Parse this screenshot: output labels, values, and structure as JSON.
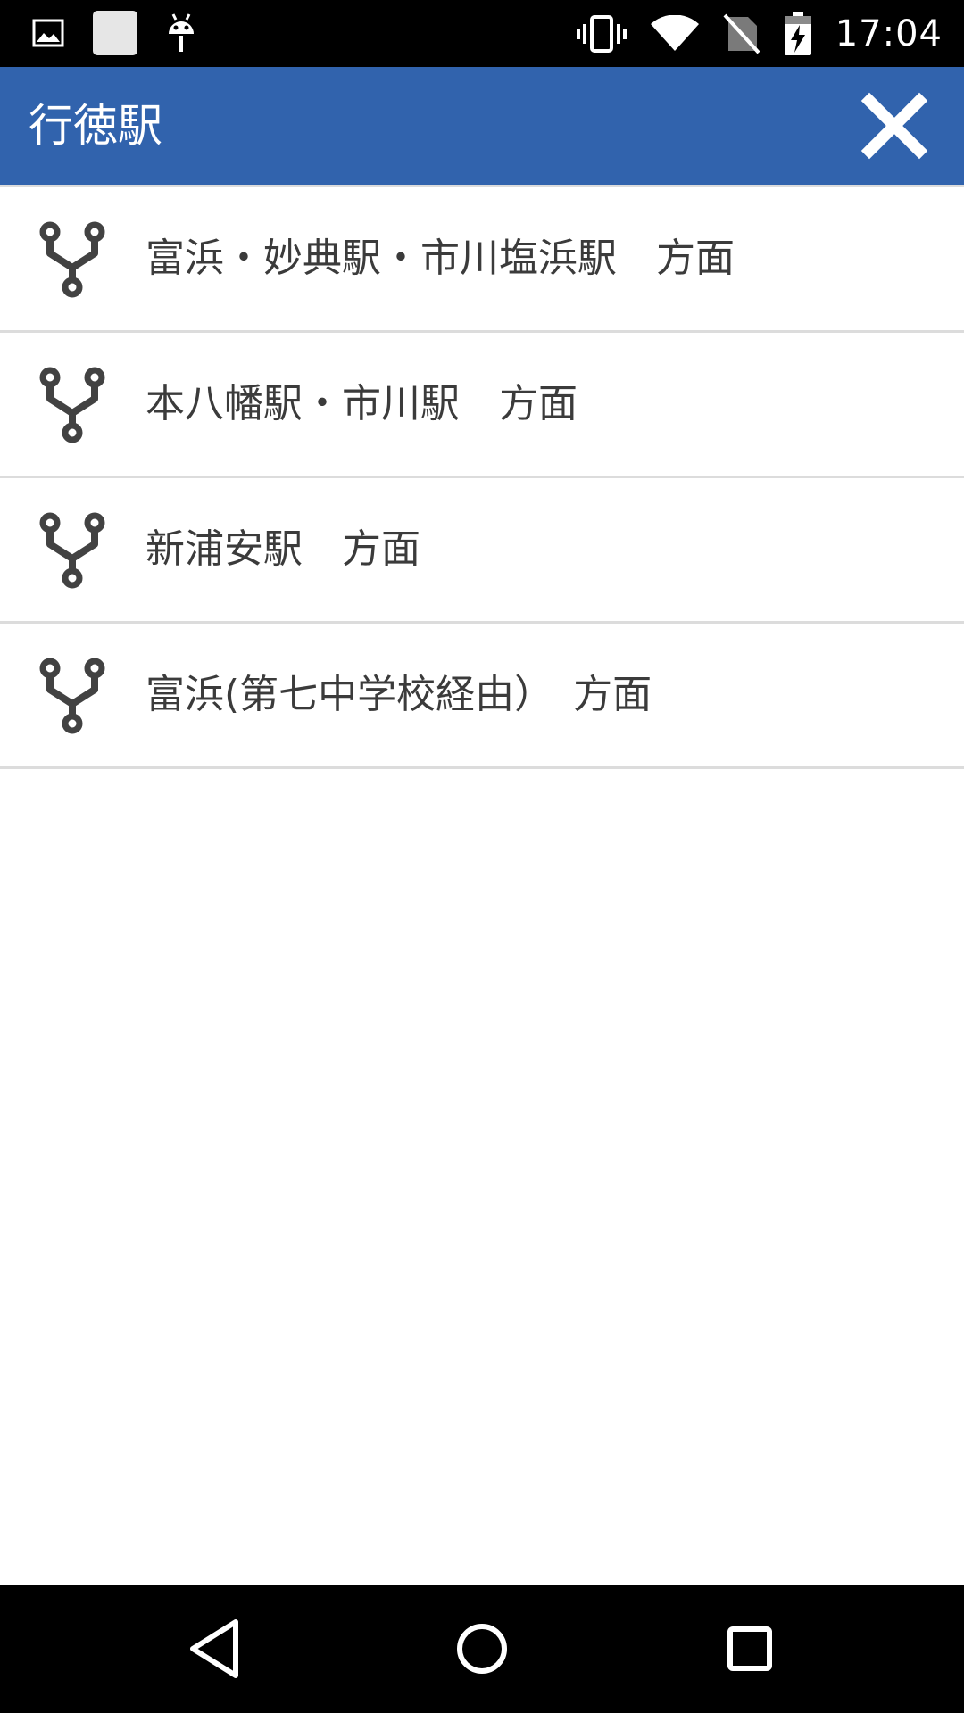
{
  "status_bar": {
    "time": "17:04",
    "left_icons": [
      "image-notification-icon",
      "blank-notification-icon",
      "android-notification-icon"
    ],
    "right_icons": [
      "vibrate-icon",
      "wifi-icon",
      "no-sim-icon",
      "battery-charging-icon"
    ]
  },
  "app_bar": {
    "title": "行徳駅",
    "close_icon": "close-icon",
    "background": "#3163ad"
  },
  "routes": [
    {
      "label": "富浜・妙典駅・市川塩浜駅　方面",
      "icon": "route-branch-icon"
    },
    {
      "label": "本八幡駅・市川駅　方面",
      "icon": "route-branch-icon"
    },
    {
      "label": "新浦安駅　方面",
      "icon": "route-branch-icon"
    },
    {
      "label": "富浜(第七中学校経由）　方面",
      "icon": "route-branch-icon"
    }
  ],
  "nav_bar": {
    "buttons": [
      "back-icon",
      "home-icon",
      "recents-icon"
    ]
  }
}
